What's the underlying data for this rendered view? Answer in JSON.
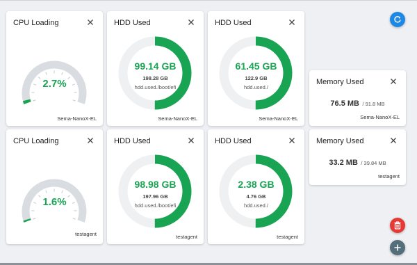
{
  "colors": {
    "accent_green": "#18a452",
    "track": "#d9dde2",
    "ring_track": "#eef0f2",
    "refresh": "#1e88e5",
    "delete": "#e53935",
    "add": "#546e7a"
  },
  "rows": [
    {
      "cpu": {
        "title": "CPU Loading",
        "value": "2.7%",
        "fraction": 0.027,
        "agent": "Sema-NanoX-EL"
      },
      "hdd1": {
        "title": "HDD Used",
        "used": "99.14 GB",
        "total": "198.28 GB",
        "path": "hdd.used./boot/efi",
        "fraction": 0.5,
        "agent": "Sema-NanoX-EL"
      },
      "hdd2": {
        "title": "HDD Used",
        "used": "61.45 GB",
        "total": "122.9 GB",
        "path": "hdd.used./",
        "fraction": 0.5,
        "agent": "Sema-NanoX-EL"
      },
      "mem": {
        "title": "Memory Used",
        "used": "76.5 MB",
        "total": "/ 91.8 MB",
        "agent": "Sema-NanoX-EL"
      }
    },
    {
      "cpu": {
        "title": "CPU Loading",
        "value": "1.6%",
        "fraction": 0.016,
        "agent": "testagent"
      },
      "hdd1": {
        "title": "HDD Used",
        "used": "98.98 GB",
        "total": "197.96 GB",
        "path": "hdd.used./boot/efi",
        "fraction": 0.5,
        "agent": "testagent"
      },
      "hdd2": {
        "title": "HDD Used",
        "used": "2.38 GB",
        "total": "4.76 GB",
        "path": "hdd.used./",
        "fraction": 0.5,
        "agent": "testagent"
      },
      "mem": {
        "title": "Memory Used",
        "used": "33.2 MB",
        "total": "/ 39.84 MB",
        "agent": "testagent"
      }
    }
  ],
  "buttons": {
    "refresh": "refresh-icon",
    "delete": "trash-icon",
    "add": "plus-icon"
  }
}
